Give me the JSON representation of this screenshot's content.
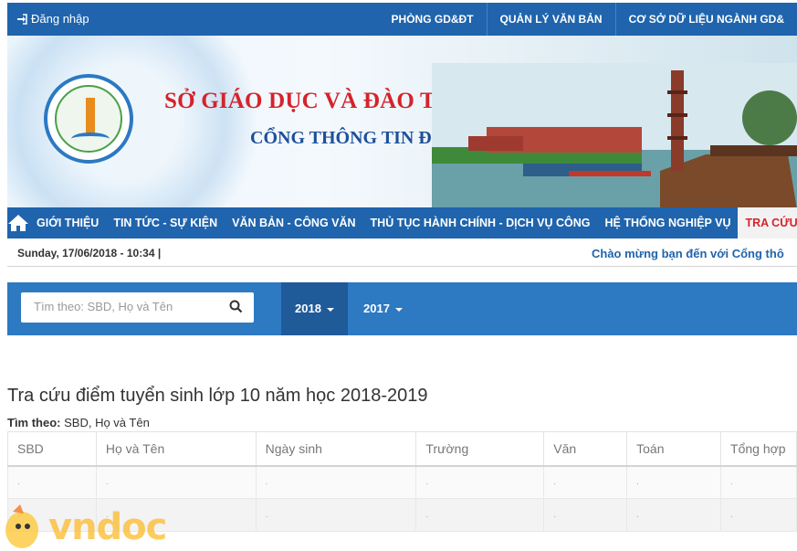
{
  "topbar": {
    "login": "Đăng nhập",
    "links": [
      "PHÒNG GD&ĐT",
      "QUẢN LÝ VĂN BẢN",
      "CƠ SỞ DỮ LIỆU NGÀNH GD&"
    ]
  },
  "banner": {
    "title": "SỞ GIÁO DỤC VÀ ĐÀO TẠO NAM ĐỊNH",
    "subtitle": "CỔNG THÔNG TIN ĐIỆN TỬ"
  },
  "nav": {
    "items": [
      "GIỚI THIỆU",
      "TIN TỨC - SỰ KIỆN",
      "VĂN BẢN - CÔNG VĂN",
      "THỦ TỤC HÀNH CHÍNH - DỊCH VỤ CÔNG",
      "HỆ THỐNG NGHIỆP VỤ",
      "TRA CỨU"
    ],
    "active": "TRA CỨU"
  },
  "status": {
    "date": "Sunday, 17/06/2018 - 10:34   |",
    "marquee": "Chào mừng bạn đến với Cổng thô"
  },
  "search": {
    "placeholder": "Tìm theo: SBD, Họ và Tên",
    "years": [
      "2018",
      "2017"
    ],
    "selected_year": "2018"
  },
  "content": {
    "heading": "Tra cứu điểm tuyển sinh lớp 10 năm học 2018-2019",
    "filter_label": "Tìm theo:",
    "filter_value": "SBD, Họ và Tên"
  },
  "table": {
    "columns": [
      "SBD",
      "Họ và Tên",
      "Ngày sinh",
      "Trường",
      "Văn",
      "Toán",
      "Tổng hợp"
    ],
    "rows": [
      [
        ".",
        ".",
        ".",
        ".",
        ".",
        ".",
        "."
      ],
      [
        ".",
        ".",
        ".",
        ".",
        ".",
        ".",
        "."
      ]
    ]
  },
  "watermark": {
    "text": "vndoc"
  },
  "colors": {
    "primary": "#1f64ad",
    "accent_red": "#d5232b",
    "search_bar": "#2d79c2"
  }
}
